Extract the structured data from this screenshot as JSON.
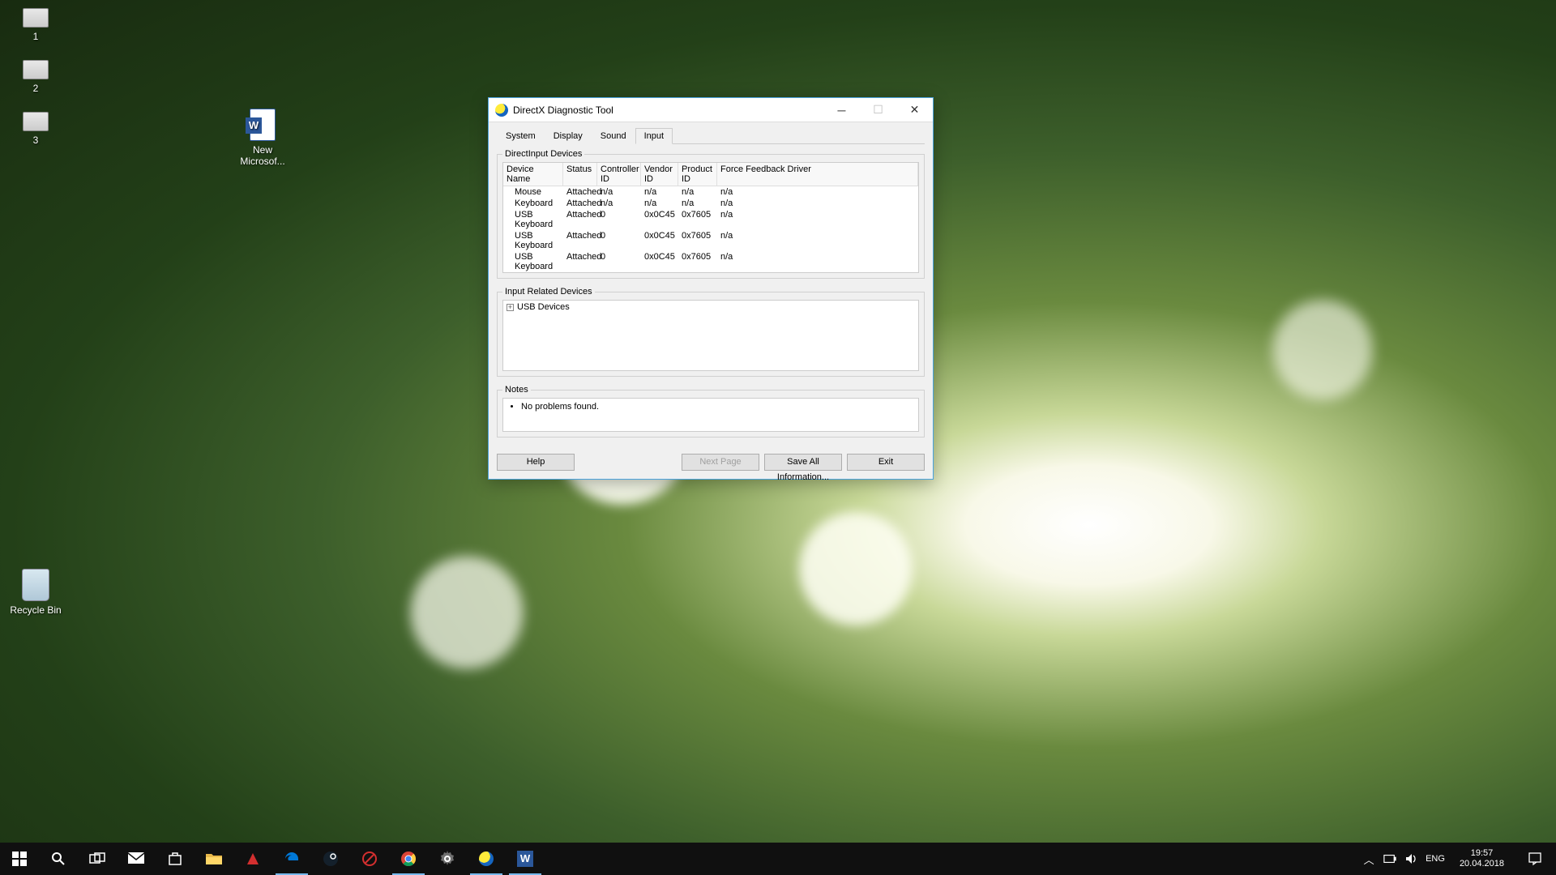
{
  "desktop": {
    "icons": [
      {
        "label": "1"
      },
      {
        "label": "2"
      },
      {
        "label": "3"
      },
      {
        "label": "New Microsof..."
      },
      {
        "label": "Recycle Bin"
      }
    ]
  },
  "window": {
    "title": "DirectX Diagnostic Tool",
    "tabs": [
      "System",
      "Display",
      "Sound",
      "Input"
    ],
    "active_tab": "Input",
    "group1_label": "DirectInput Devices",
    "columns": [
      "Device Name",
      "Status",
      "Controller ID",
      "Vendor ID",
      "Product ID",
      "Force Feedback Driver"
    ],
    "rows": [
      {
        "name": "Mouse",
        "status": "Attached",
        "ctrl": "n/a",
        "vend": "n/a",
        "prod": "n/a",
        "ff": "n/a"
      },
      {
        "name": "Keyboard",
        "status": "Attached",
        "ctrl": "n/a",
        "vend": "n/a",
        "prod": "n/a",
        "ff": "n/a"
      },
      {
        "name": "USB Keyboard",
        "status": "Attached",
        "ctrl": "0",
        "vend": "0x0C45",
        "prod": "0x7605",
        "ff": "n/a"
      },
      {
        "name": "USB Keyboard",
        "status": "Attached",
        "ctrl": "0",
        "vend": "0x0C45",
        "prod": "0x7605",
        "ff": "n/a"
      },
      {
        "name": "USB Keyboard",
        "status": "Attached",
        "ctrl": "0",
        "vend": "0x0C45",
        "prod": "0x7605",
        "ff": "n/a"
      }
    ],
    "group2_label": "Input Related Devices",
    "tree_root": "USB Devices",
    "group3_label": "Notes",
    "notes": "No problems found.",
    "buttons": {
      "help": "Help",
      "next": "Next Page",
      "save": "Save All Information...",
      "exit": "Exit"
    }
  },
  "taskbar": {
    "lang": "ENG",
    "time": "19:57",
    "date": "20.04.2018"
  }
}
